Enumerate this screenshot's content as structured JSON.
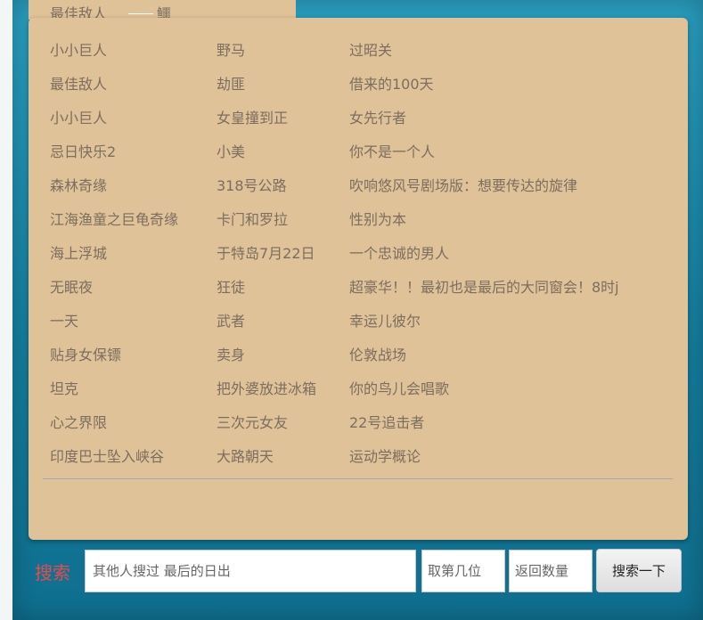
{
  "top_row": {
    "text": "最佳敌人",
    "tail": "鱷"
  },
  "list": {
    "rows": [
      [
        "小小巨人",
        "野马",
        "过昭关"
      ],
      [
        "最佳敌人",
        "劫匪",
        "借来的100天"
      ],
      [
        "小小巨人",
        "女皇撞到正",
        "女先行者"
      ],
      [
        "忌日快乐2",
        "小美",
        "你不是一个人"
      ],
      [
        "森林奇缘",
        "318号公路",
        "吹响悠风号剧场版：想要传达的旋律"
      ],
      [
        "江海渔童之巨龟奇缘",
        "卡门和罗拉",
        "性别为本"
      ],
      [
        "海上浮城",
        "于特岛7月22日",
        "一个忠诚的男人"
      ],
      [
        "无眠夜",
        "狂徒",
        "超豪华！！最初也是最后的大同窗会！8时j"
      ],
      [
        "一天",
        "武者",
        "幸运儿彼尔"
      ],
      [
        "贴身女保镖",
        "卖身",
        "伦敦战场"
      ],
      [
        "坦克",
        "把外婆放进冰箱",
        "你的鸟儿会唱歌"
      ],
      [
        "心之界限",
        "三次元女友",
        "22号追击者"
      ],
      [
        "印度巴士坠入峡谷",
        "大路朝天",
        "运动学概论"
      ]
    ]
  },
  "search": {
    "label": "搜索",
    "placeholder": "其他人搜过 最后的日出",
    "position_placeholder": "取第几位",
    "count_placeholder": "返回数量",
    "button_label": "搜索一下"
  },
  "colors": {
    "panel": "#e0c298",
    "frame": "#1e8fb0",
    "item_text": "#7b6e60",
    "search_label": "#e54b4b"
  }
}
